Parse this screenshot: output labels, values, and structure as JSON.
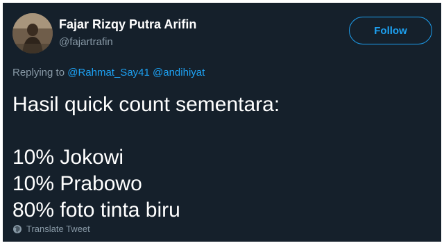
{
  "user": {
    "display_name": "Fajar Rizqy Putra Arifin",
    "handle": "@fajartrafin"
  },
  "follow_button": {
    "label": "Follow"
  },
  "reply": {
    "prefix": "Replying to",
    "mentions": [
      "@Rahmat_Say41",
      "@andihiyat"
    ]
  },
  "tweet": {
    "lines": [
      "Hasil quick count sementara:",
      "",
      "10% Jokowi",
      "10% Prabowo",
      "80% foto tinta biru"
    ]
  },
  "translate": {
    "label": "Translate Tweet",
    "icon": "globe-icon"
  },
  "colors": {
    "background": "#15202b",
    "accent": "#1da1f2",
    "secondary_text": "#8899a6",
    "primary_text": "#ffffff"
  }
}
